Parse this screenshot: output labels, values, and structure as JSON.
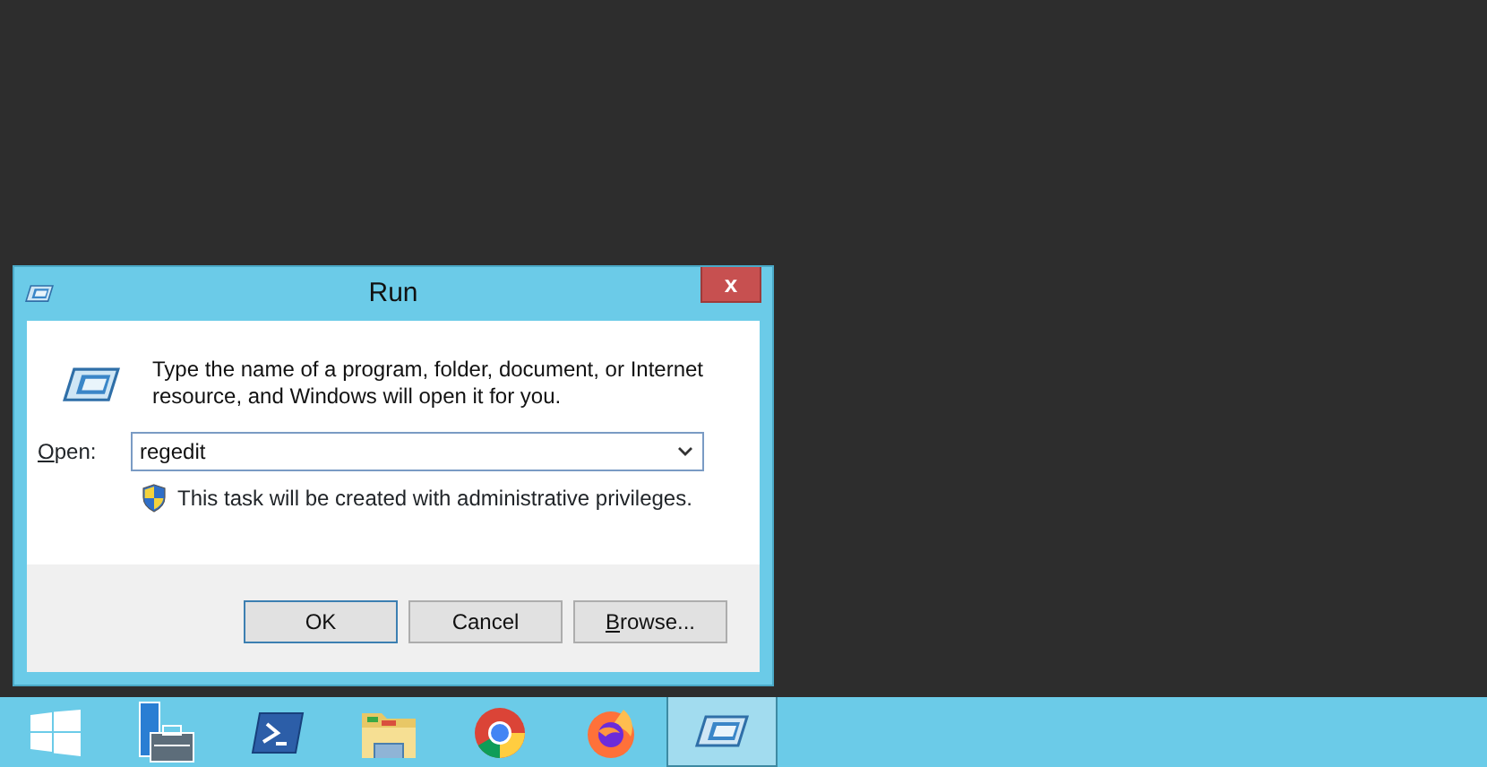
{
  "window": {
    "title": "Run",
    "close": "x"
  },
  "description": "Type the name of a program, folder, document, or Internet resource, and Windows will open it for you.",
  "open_field": {
    "label": "Open:",
    "first_letter_underlined": true,
    "value": "regedit"
  },
  "notice": "This task will be created with administrative privileges.",
  "buttons": [
    {
      "label": "OK",
      "first_letter_underlined": false,
      "default": true
    },
    {
      "label": "Cancel",
      "first_letter_underlined": false,
      "default": false
    },
    {
      "label": "Browse...",
      "first_letter_underlined": true,
      "default": false
    }
  ],
  "taskbar": [
    {
      "kind": "start",
      "selected": false
    },
    {
      "kind": "server",
      "selected": false
    },
    {
      "kind": "shell",
      "selected": false
    },
    {
      "kind": "folder",
      "selected": false
    },
    {
      "kind": "chrome",
      "selected": false
    },
    {
      "kind": "firefox",
      "selected": false
    },
    {
      "kind": "run",
      "selected": true
    }
  ]
}
